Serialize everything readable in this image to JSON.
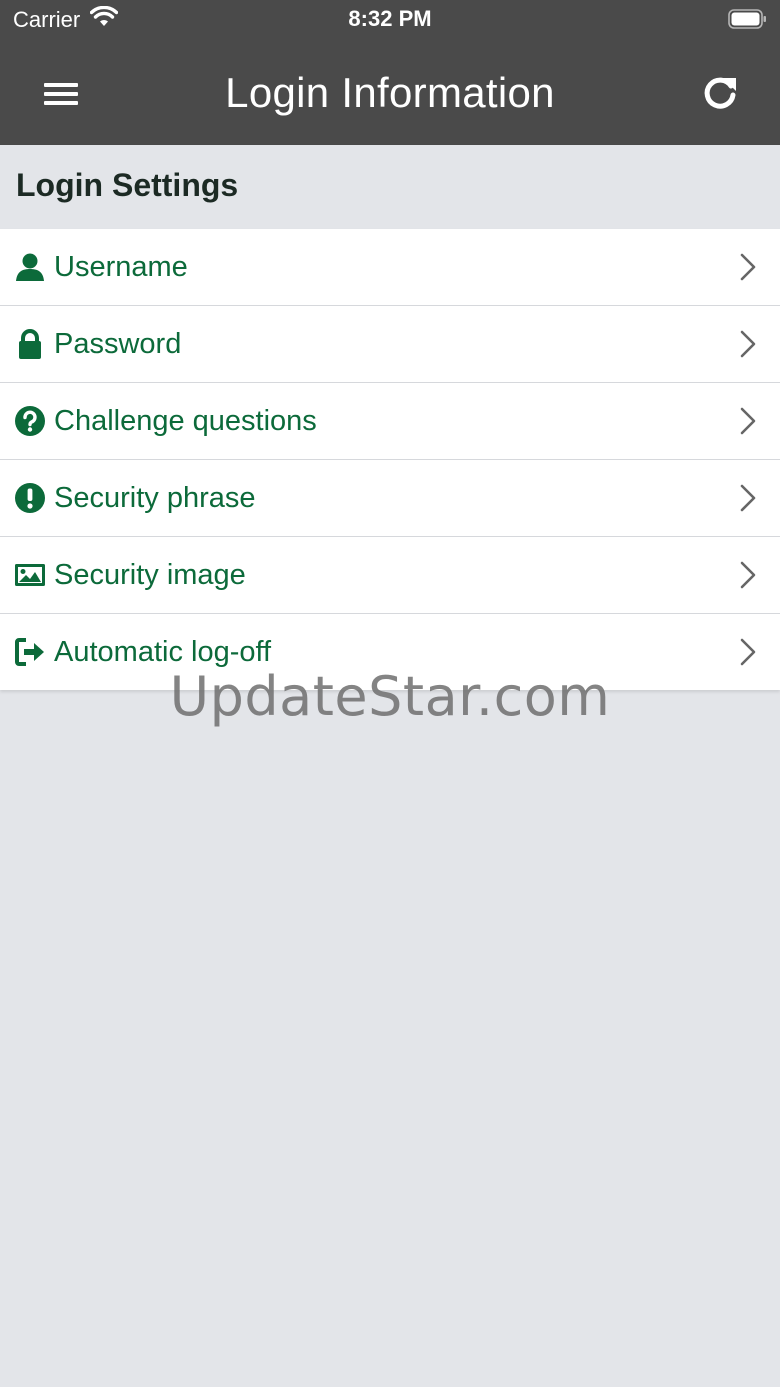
{
  "status_bar": {
    "carrier": "Carrier",
    "time": "8:32 PM",
    "wifi_icon": "wifi-icon",
    "battery_icon": "battery-full-icon"
  },
  "nav": {
    "title": "Login Information",
    "menu_icon": "hamburger-menu-icon",
    "refresh_icon": "refresh-icon"
  },
  "section": {
    "title": "Login Settings"
  },
  "items": [
    {
      "label": "Username",
      "icon": "user-icon"
    },
    {
      "label": "Password",
      "icon": "lock-icon"
    },
    {
      "label": "Challenge questions",
      "icon": "question-circle-icon"
    },
    {
      "label": "Security phrase",
      "icon": "exclamation-circle-icon"
    },
    {
      "label": "Security image",
      "icon": "image-icon"
    },
    {
      "label": "Automatic log-off",
      "icon": "sign-out-icon"
    }
  ],
  "watermark": "UpdateStar.com",
  "colors": {
    "nav_background": "#4a4a4a",
    "accent_green": "#0c6a3a",
    "page_background": "#e3e5e9",
    "list_background": "#ffffff"
  }
}
